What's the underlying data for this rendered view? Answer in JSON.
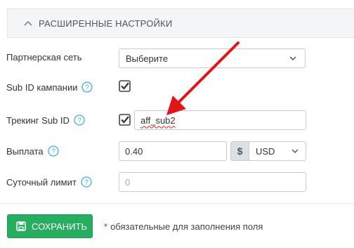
{
  "section": {
    "title": "РАСШИРЕННЫЕ НАСТРОЙКИ",
    "icon": "chevron-up-icon"
  },
  "form": {
    "partner_network": {
      "label": "Партнерская сеть",
      "value": "Выберите"
    },
    "campaign_sub_id": {
      "label": "Sub ID кампании",
      "checked": true
    },
    "tracking_sub_id": {
      "label": "Трекинг Sub ID",
      "checked": true,
      "value": "aff_sub2"
    },
    "payout": {
      "label": "Выплата",
      "value": "0.40",
      "currency_symbol": "$",
      "currency": "USD"
    },
    "daily_limit": {
      "label": "Суточный лимит",
      "placeholder": "0"
    }
  },
  "footer": {
    "save_label": "СОХРАНИТЬ",
    "required_star": "*",
    "required_note": "обязательные для заполнения поля"
  },
  "colors": {
    "accent": "#27ad60",
    "help": "#3bb0e0",
    "arrow": "#e0151a"
  }
}
